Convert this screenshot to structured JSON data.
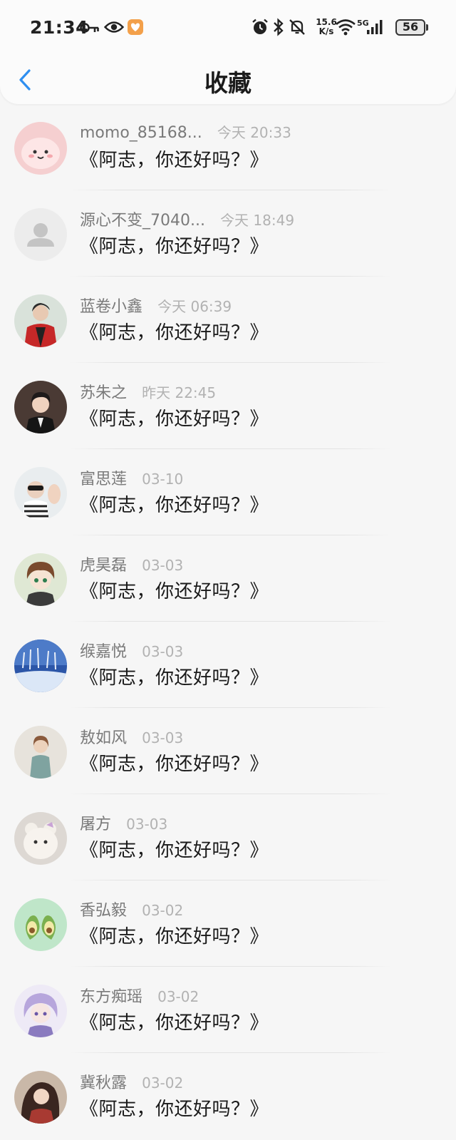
{
  "status_bar": {
    "time": "21:34",
    "net_speed_value": "15.6",
    "net_speed_unit": "K/s",
    "network_type": "5G",
    "battery": "56",
    "icons": [
      "key-icon",
      "eye-icon",
      "app-badge-icon",
      "alarm-icon",
      "bluetooth-icon",
      "mute-icon",
      "wifi-icon",
      "signal-icon",
      "battery-icon"
    ]
  },
  "nav": {
    "back_icon": "chevron-left-icon",
    "title": "收藏"
  },
  "colors": {
    "accent": "#2f8ff0",
    "background": "#f6f6f6"
  },
  "items": [
    {
      "name": "momo_85168...",
      "date": "今天 20:33",
      "message": "《阿志，你还好吗？》"
    },
    {
      "name": "源心不变_7040...",
      "date": "今天 18:49",
      "message": "《阿志，你还好吗？》"
    },
    {
      "name": "蓝卷小鑫",
      "date": "今天 06:39",
      "message": "《阿志，你还好吗？》"
    },
    {
      "name": "苏朱之",
      "date": "昨天 22:45",
      "message": "《阿志，你还好吗？》"
    },
    {
      "name": "富思莲",
      "date": "03-10",
      "message": "《阿志，你还好吗？》"
    },
    {
      "name": "虎昊磊",
      "date": "03-03",
      "message": "《阿志，你还好吗？》"
    },
    {
      "name": "缑嘉悦",
      "date": "03-03",
      "message": "《阿志，你还好吗？》"
    },
    {
      "name": "敖如风",
      "date": "03-03",
      "message": "《阿志，你还好吗？》"
    },
    {
      "name": "屠方",
      "date": "03-03",
      "message": "《阿志，你还好吗？》"
    },
    {
      "name": "香弘毅",
      "date": "03-02",
      "message": "《阿志，你还好吗？》"
    },
    {
      "name": "东方痴瑶",
      "date": "03-02",
      "message": "《阿志，你还好吗？》"
    },
    {
      "name": "冀秋露",
      "date": "03-02",
      "message": "《阿志，你还好吗？》"
    }
  ]
}
